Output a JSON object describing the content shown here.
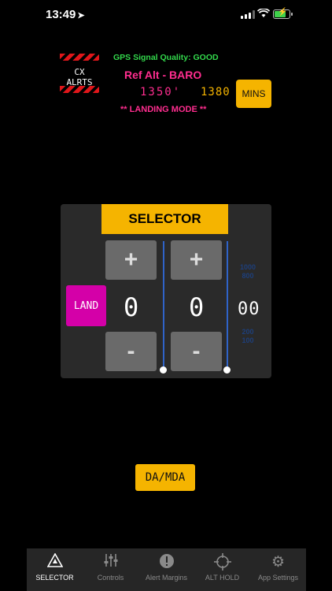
{
  "status": {
    "time": "13:49",
    "location_icon": "location-arrow-icon"
  },
  "header": {
    "logo_text": "CX ALRTS",
    "gps_signal": "GPS Signal Quality: GOOD",
    "ref_alt": "Ref Alt - BARO",
    "alt_primary": "1350'",
    "alt_secondary": "1380",
    "mins_label": "MINS",
    "mode": "** LANDING MODE **"
  },
  "selector": {
    "title": "SELECTOR",
    "land_label": "LAND",
    "digit_1": "0",
    "digit_2": "0",
    "units_digits": "00",
    "plus": "+",
    "minus": "-",
    "ghost_top": "1000 800",
    "ghost_bottom": "200 100"
  },
  "da_mda_label": "DA/MDA",
  "colors": {
    "accent": "#f5b400",
    "magenta": "#d400a8",
    "pink": "#ff2d8f",
    "green": "#32d74b",
    "blue_line": "#2f63c8"
  },
  "tabs": [
    {
      "label": "SELECTOR",
      "icon": "warning-triangle-icon",
      "active": true
    },
    {
      "label": "Controls",
      "icon": "sliders-icon",
      "active": false
    },
    {
      "label": "Alert Margins",
      "icon": "alert-circle-icon",
      "active": false
    },
    {
      "label": "ALT HOLD",
      "icon": "crosshair-icon",
      "active": false
    },
    {
      "label": "App Settings",
      "icon": "gear-icon",
      "active": false
    }
  ]
}
